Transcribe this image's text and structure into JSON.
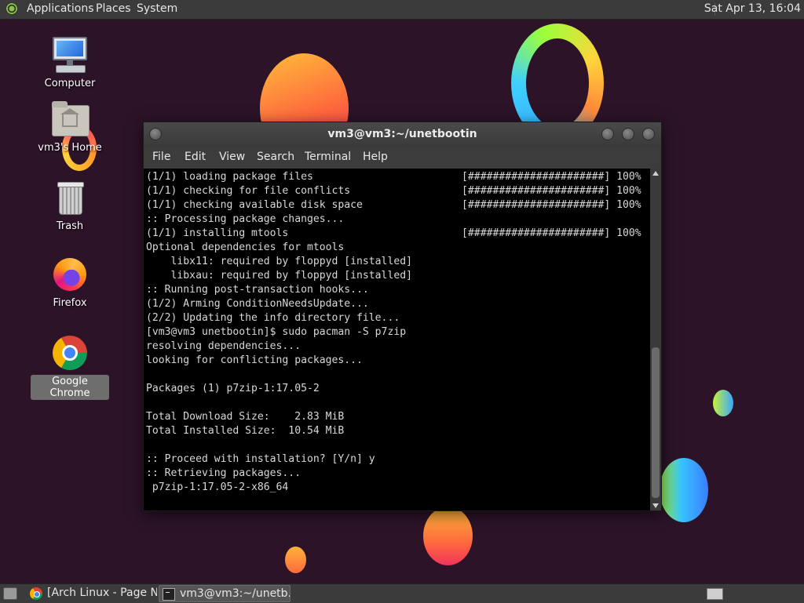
{
  "top_panel": {
    "menus": [
      "Applications",
      "Places",
      "System"
    ],
    "clock": "Sat Apr 13, 16:04"
  },
  "desktop_icons": [
    {
      "label": "Computer",
      "icon": "computer-icon"
    },
    {
      "label": "vm3's Home",
      "icon": "home-folder-icon"
    },
    {
      "label": "Trash",
      "icon": "trash-icon"
    },
    {
      "label": "Firefox",
      "icon": "firefox-icon"
    },
    {
      "label": "Google Chrome",
      "icon": "chrome-icon",
      "selected": true
    }
  ],
  "terminal": {
    "title": "vm3@vm3:~/unetbootin",
    "menu": [
      "File",
      "Edit",
      "View",
      "Search",
      "Terminal",
      "Help"
    ],
    "lines": [
      "(1/1) loading package files                        [######################] 100%",
      "(1/1) checking for file conflicts                  [######################] 100%",
      "(1/1) checking available disk space                [######################] 100%",
      ":: Processing package changes...",
      "(1/1) installing mtools                            [######################] 100%",
      "Optional dependencies for mtools",
      "    libx11: required by floppyd [installed]",
      "    libxau: required by floppyd [installed]",
      ":: Running post-transaction hooks...",
      "(1/2) Arming ConditionNeedsUpdate...",
      "(2/2) Updating the info directory file...",
      "[vm3@vm3 unetbootin]$ sudo pacman -S p7zip",
      "resolving dependencies...",
      "looking for conflicting packages...",
      "",
      "Packages (1) p7zip-1:17.05-2",
      "",
      "Total Download Size:    2.83 MiB",
      "Total Installed Size:  10.54 MiB",
      "",
      ":: Proceed with installation? [Y/n] y",
      ":: Retrieving packages...",
      " p7zip-1:17.05-2-x86_64"
    ]
  },
  "taskbar": {
    "tasks": [
      {
        "label": "[Arch Linux - Page N...",
        "icon": "chrome-icon",
        "active": false
      },
      {
        "label": "vm3@vm3:~/unetb...",
        "icon": "terminal-icon",
        "active": true
      }
    ]
  },
  "colors": {
    "desktop_background": "#2c1328",
    "panel": "#3b3b3b",
    "terminal_background": "#000000",
    "terminal_text": "#d8d8d8"
  }
}
